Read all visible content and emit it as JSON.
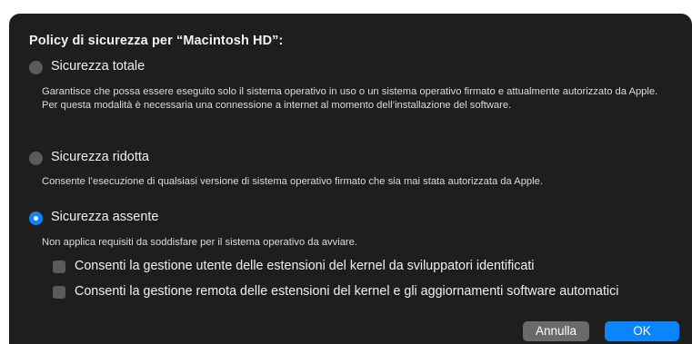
{
  "dialog": {
    "title": "Policy di sicurezza per “Macintosh HD”:"
  },
  "options": [
    {
      "label": "Sicurezza totale",
      "selected": false,
      "description": "Garantisce che possa essere eseguito solo il sistema operativo in uso o un sistema operativo firmato e attualmente autorizzato da Apple. Per questa modalità è necessaria una connessione a internet al momento dell’installazione del software."
    },
    {
      "label": "Sicurezza ridotta",
      "selected": false,
      "description": "Consente l’esecuzione di qualsiasi versione di sistema operativo firmato che sia mai stata autorizzata da Apple."
    },
    {
      "label": "Sicurezza assente",
      "selected": true,
      "description": "Non applica requisiti da soddisfare per il sistema operativo da avviare."
    }
  ],
  "checkboxes": [
    {
      "label": "Consenti la gestione utente delle estensioni del kernel da sviluppatori identificati",
      "checked": false
    },
    {
      "label": "Consenti la gestione remota delle estensioni del kernel e gli aggiornamenti software automatici",
      "checked": false
    }
  ],
  "buttons": {
    "cancel_label": "Annulla",
    "ok_label": "OK"
  },
  "colors": {
    "dialog_background": "#1e1e1e",
    "accent": "#0a84ff",
    "control_gray": "#5b5b5d"
  }
}
